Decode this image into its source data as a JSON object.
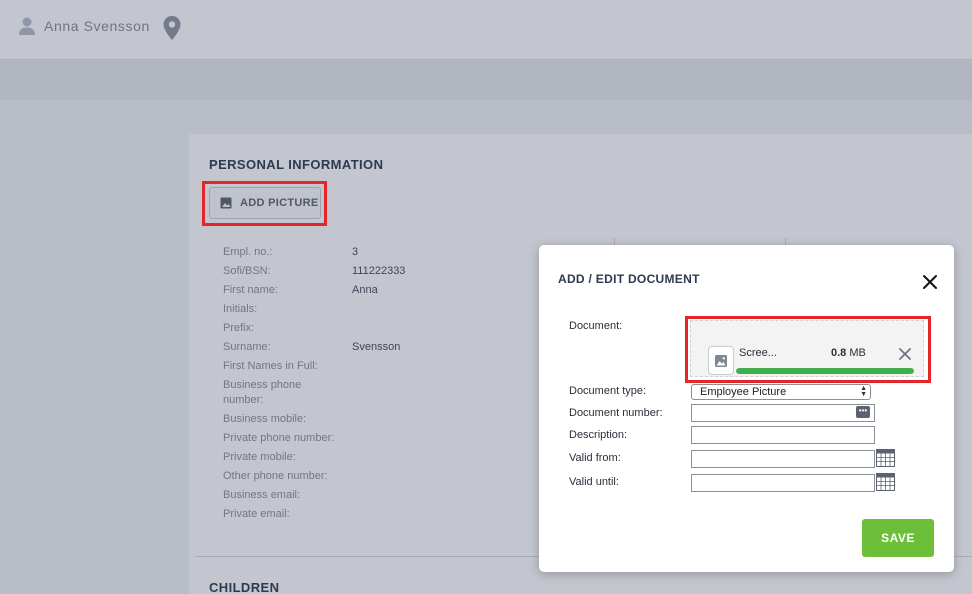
{
  "header": {
    "user_name": "Anna Svensson"
  },
  "personal_information": {
    "title": "PERSONAL INFORMATION",
    "add_picture_label": "ADD PICTURE",
    "fields": [
      {
        "label": "Empl. no.:",
        "value": "3"
      },
      {
        "label": "Sofi/BSN:",
        "value": "111222333"
      },
      {
        "label": "First name:",
        "value": "Anna"
      },
      {
        "label": "Initials:",
        "value": ""
      },
      {
        "label": "Prefix:",
        "value": ""
      },
      {
        "label": "Surname:",
        "value": "Svensson"
      },
      {
        "label": "First Names in Full:",
        "value": ""
      },
      {
        "label": "Business phone",
        "value": ""
      },
      {
        "label": "number:",
        "value": ""
      },
      {
        "label": "Business mobile:",
        "value": ""
      },
      {
        "label": "Private phone number:",
        "value": ""
      },
      {
        "label": "Private mobile:",
        "value": ""
      },
      {
        "label": "Other phone number:",
        "value": ""
      },
      {
        "label": "Business email:",
        "value": ""
      },
      {
        "label": "Private email:",
        "value": ""
      }
    ]
  },
  "children": {
    "title": "CHILDREN"
  },
  "modal": {
    "title": "ADD / EDIT DOCUMENT",
    "labels": {
      "document": "Document:",
      "document_type": "Document type:",
      "document_number": "Document number:",
      "description": "Description:",
      "valid_from": "Valid from:",
      "valid_until": "Valid until:"
    },
    "file": {
      "name": "Scree...",
      "size_value": "0.8",
      "size_unit": "MB",
      "progress": 1.0
    },
    "document_type_value": "Employee Picture",
    "document_number_value": "",
    "description_value": "",
    "valid_from_value": "",
    "valid_until_value": "",
    "save_label": "SAVE"
  },
  "colors": {
    "highlight": "#e3262a",
    "save_button": "#6dbf3a",
    "progress": "#3fae4c",
    "heading": "#2e3a50"
  },
  "icons": [
    "person-icon",
    "location-pin-icon",
    "image-icon",
    "close-icon",
    "calendar-icon",
    "ellipsis-icon"
  ]
}
